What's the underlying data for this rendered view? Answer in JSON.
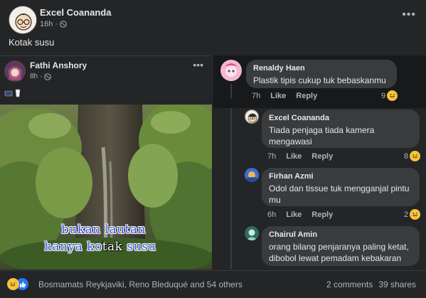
{
  "post": {
    "author": "Excel Coananda",
    "time": "16h",
    "caption": "Kotak susu"
  },
  "shared_post": {
    "author": "Fathi Anshory",
    "time": "8h",
    "lyrics": {
      "line1": "bukan lautan",
      "line2_a": "hanya ko",
      "line2_hl": "tak",
      "line2_b": " susu"
    }
  },
  "comments": [
    {
      "name": "Renaldy Haen",
      "text": "Plastik tipis cukup tuk bebaskanmu",
      "time": "7h",
      "like": "Like",
      "reply": "Reply",
      "reactions": "9"
    },
    {
      "name": "Excel Coananda",
      "text": "Tiada penjaga tiada kamera mengawasi",
      "time": "7h",
      "like": "Like",
      "reply": "Reply",
      "reactions": "8"
    },
    {
      "name": "Firhan Azmi",
      "text": "Odol dan tissue tuk mengganjal pintu mu",
      "time": "6h",
      "like": "Like",
      "reply": "Reply",
      "reactions": "2"
    },
    {
      "name": "Chairul Amin",
      "text": "orang bilang penjaranya paling ketat, dibobol lewat pemadam kebakaran"
    }
  ],
  "footer": {
    "reactors": "Bosmamats Reykjaviki, Reno Bleduqué and 54 others",
    "comments": "2 comments",
    "shares": "39 shares"
  },
  "colors": {
    "background": "#242526",
    "bubble": "#3a3b3c",
    "text": "#e4e6eb",
    "muted": "#b0b3b8",
    "like_blue": "#2078f4",
    "haha_yellow": "#f7c33e"
  }
}
